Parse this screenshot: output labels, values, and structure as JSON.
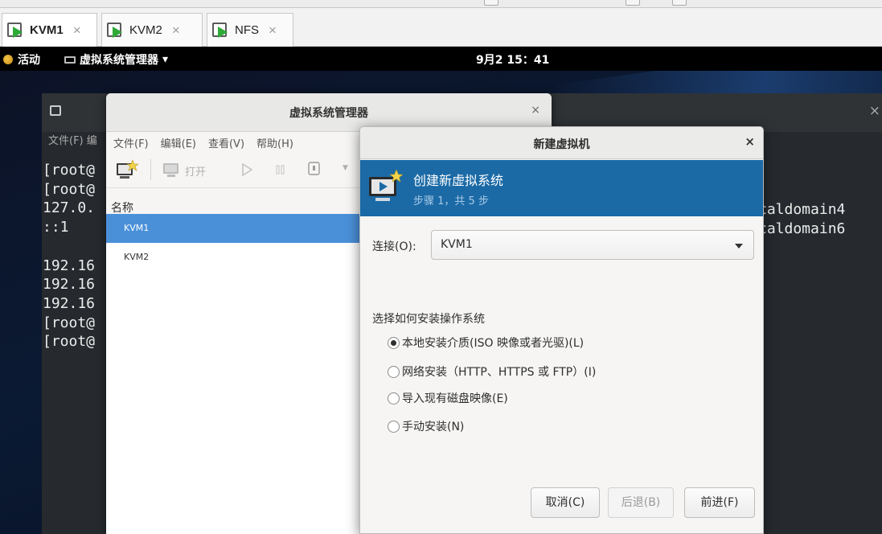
{
  "host": {
    "tabs": [
      {
        "label": "KVM1",
        "active": true
      },
      {
        "label": "KVM2",
        "active": false
      },
      {
        "label": "NFS",
        "active": false
      }
    ],
    "tab_close_glyph": "×"
  },
  "gnome": {
    "activities": "活动",
    "app_menu": "虚拟系统管理器",
    "app_menu_caret": "▾",
    "clock": "9月2 15：41"
  },
  "terminal": {
    "menu": "文件(F)  编",
    "close_glyph": "×",
    "lines": [
      "[root@",
      "[root@",
      "127.0.",
      "::1",
      "",
      "192.16",
      "192.16",
      "192.16",
      "[root@",
      "[root@"
    ],
    "right_lines": [
      "caldomain4",
      "caldomain6"
    ]
  },
  "vmm": {
    "title": "虚拟系统管理器",
    "close_glyph": "×",
    "menu": [
      "文件(F)",
      "编辑(E)",
      "查看(V)",
      "帮助(H)"
    ],
    "toolbar": {
      "open_label": "打开"
    },
    "list_header": "名称",
    "vms": [
      {
        "name": "KVM1",
        "selected": true
      },
      {
        "name": "KVM2",
        "selected": false
      }
    ]
  },
  "dialog": {
    "title": "新建虚拟机",
    "close_glyph": "×",
    "banner_title": "创建新虚拟系统",
    "banner_subtitle": "步骤 1，共 5 步",
    "connection_label": "连接(O):",
    "connection_value": "KVM1",
    "section_label": "选择如何安装操作系统",
    "options": [
      {
        "label": "本地安装介质(ISO 映像或者光驱)(L)",
        "selected": true
      },
      {
        "label": "网络安装（HTTP、HTTPS 或 FTP）(I)",
        "selected": false
      },
      {
        "label": "导入现有磁盘映像(E)",
        "selected": false
      },
      {
        "label": "手动安装(N)",
        "selected": false
      }
    ],
    "buttons": {
      "cancel": "取消(C)",
      "back": "后退(B)",
      "forward": "前进(F)"
    }
  },
  "colors": {
    "banner": "#1b6aa6",
    "selection": "#4a90d9",
    "vm_tab_play": "#2eaa37"
  }
}
